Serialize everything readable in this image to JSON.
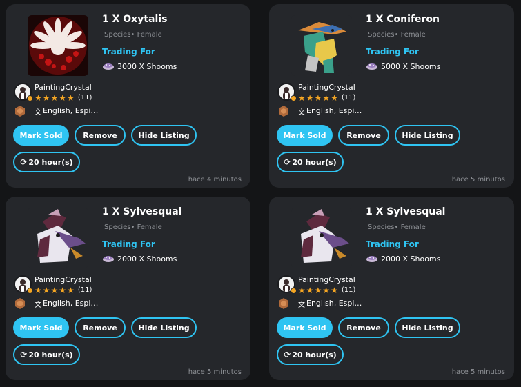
{
  "listings": [
    {
      "title": "1 X Oxytalis",
      "species": "Species• Female",
      "trading_for_label": "Trading For",
      "price": "3000 X Shooms",
      "pet_icon": "oxytalis-pet-image",
      "seller": {
        "name": "PaintingCrystal",
        "rating_stars": 5,
        "rating_count": "(11)",
        "languages": "English, Espi…"
      },
      "buttons": {
        "mark_sold": "Mark Sold",
        "remove": "Remove",
        "hide_listing": "Hide Listing",
        "timer": "20 hour(s)"
      },
      "timestamp": "hace 4 minutos"
    },
    {
      "title": "1 X Coniferon",
      "species": "Species• Female",
      "trading_for_label": "Trading For",
      "price": "5000 X Shooms",
      "pet_icon": "coniferon-pet-image",
      "seller": {
        "name": "PaintingCrystal",
        "rating_stars": 5,
        "rating_count": "(11)",
        "languages": "English, Espi…"
      },
      "buttons": {
        "mark_sold": "Mark Sold",
        "remove": "Remove",
        "hide_listing": "Hide Listing",
        "timer": "20 hour(s)"
      },
      "timestamp": "hace 5 minutos"
    },
    {
      "title": "1 X Sylvesqual",
      "species": "Species• Female",
      "trading_for_label": "Trading For",
      "price": "2000 X Shooms",
      "pet_icon": "sylvesqual-pet-image",
      "seller": {
        "name": "PaintingCrystal",
        "rating_stars": 5,
        "rating_count": "(11)",
        "languages": "English, Espi…"
      },
      "buttons": {
        "mark_sold": "Mark Sold",
        "remove": "Remove",
        "hide_listing": "Hide Listing",
        "timer": "20 hour(s)"
      },
      "timestamp": "hace 5 minutos"
    },
    {
      "title": "1 X Sylvesqual",
      "species": "Species• Female",
      "trading_for_label": "Trading For",
      "price": "2000 X Shooms",
      "pet_icon": "sylvesqual-pet-image",
      "seller": {
        "name": "PaintingCrystal",
        "rating_stars": 5,
        "rating_count": "(11)",
        "languages": "English, Espi…"
      },
      "buttons": {
        "mark_sold": "Mark Sold",
        "remove": "Remove",
        "hide_listing": "Hide Listing",
        "timer": "20 hour(s)"
      },
      "timestamp": "hace 5 minutos"
    }
  ],
  "colors": {
    "background": "#141517",
    "card": "#25272b",
    "accent": "#2fc4f2",
    "star": "#f5a623",
    "muted": "#8e9196"
  },
  "icons": {
    "currency": "shoom-icon",
    "rank": "bronze-rank-icon",
    "language": "translate-icon",
    "refresh": "refresh-icon",
    "star": "star-icon",
    "avatar": "seller-avatar"
  }
}
